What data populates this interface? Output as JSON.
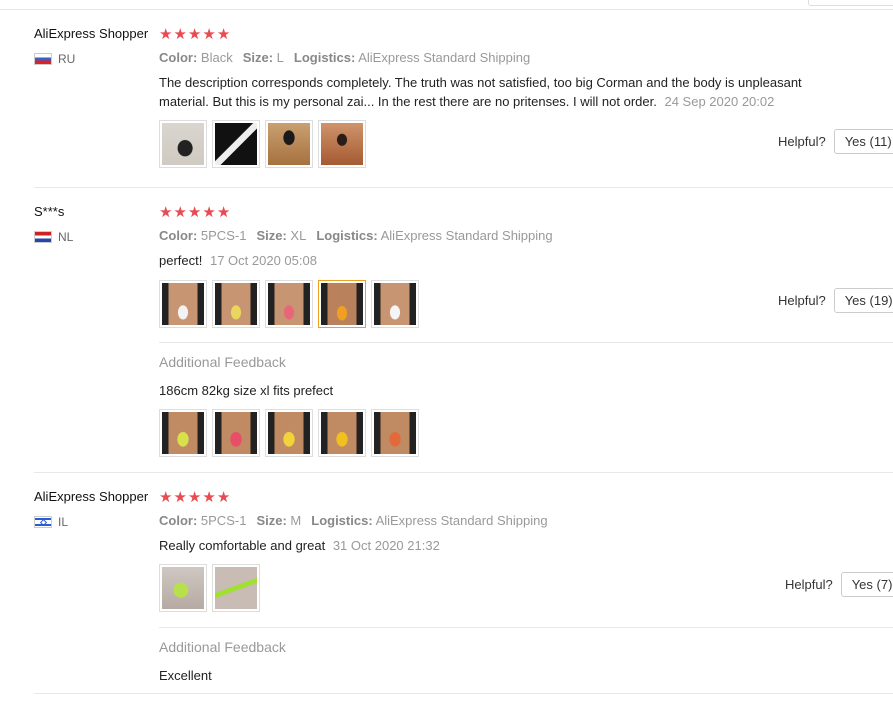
{
  "reviews": [
    {
      "user": "AliExpress Shopper",
      "country": "RU",
      "rating": 5,
      "color_label": "Color:",
      "color": "Black",
      "size_label": "Size:",
      "size": "L",
      "logistics_label": "Logistics:",
      "logistics": "AliExpress Standard Shipping",
      "text_line1": "The description corresponds completely. The truth was not satisfied, too big Corman and the body is unpleasant",
      "text_line2": "material. But this is my personal zai... In the rest there are no pritenses. I will not order.",
      "date": "24 Sep 2020 20:02",
      "helpful_label": "Helpful?",
      "yes_label": "Yes (11)"
    },
    {
      "user": "S***s",
      "country": "NL",
      "rating": 5,
      "color_label": "Color:",
      "color": "5PCS-1",
      "size_label": "Size:",
      "size": "XL",
      "logistics_label": "Logistics:",
      "logistics": "AliExpress Standard Shipping",
      "text": "perfect!",
      "date": "17 Oct 2020 05:08",
      "helpful_label": "Helpful?",
      "yes_label": "Yes (19)",
      "additional_title": "Additional Feedback",
      "additional_text": "186cm 82kg size xl fits prefect"
    },
    {
      "user": "AliExpress Shopper",
      "country": "IL",
      "rating": 5,
      "color_label": "Color:",
      "color": "5PCS-1",
      "size_label": "Size:",
      "size": "M",
      "logistics_label": "Logistics:",
      "logistics": "AliExpress Standard Shipping",
      "text": "Really comfortable and great",
      "date": "31 Oct 2020 21:32",
      "helpful_label": "Helpful?",
      "yes_label": "Yes (7)",
      "additional_title": "Additional Feedback",
      "additional_text": "Excellent"
    }
  ],
  "colors": {
    "star": "#e84b52",
    "active_thumb_border": "#f0a020"
  }
}
